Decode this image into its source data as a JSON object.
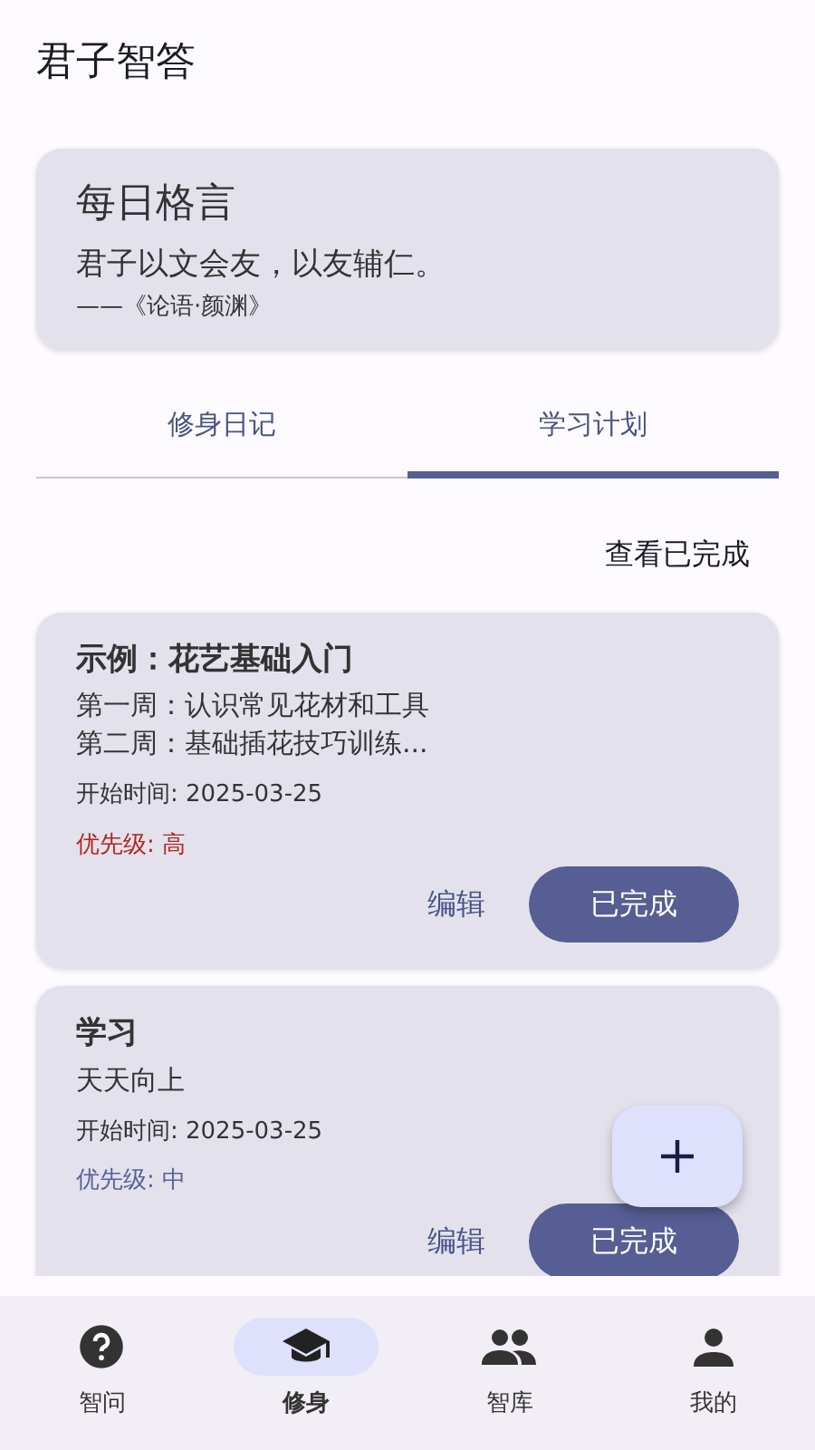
{
  "app_bar": {
    "title": "君子智答"
  },
  "quote_card": {
    "title": "每日格言",
    "text": "君子以文会友，以友辅仁。",
    "source": "——《论语·颜渊》"
  },
  "tabs": [
    {
      "label": "修身日记",
      "selected": false
    },
    {
      "label": "学习计划",
      "selected": true
    }
  ],
  "view_completed_link": "查看已完成",
  "plans": [
    {
      "title": "示例：花艺基础入门",
      "description": [
        "第一周：认识常见花材和工具",
        "第二周：基础插花技巧训练..."
      ],
      "start": "开始时间: 2025-03-25",
      "priority": "优先级: 高",
      "color": "#b3261e",
      "edit": "编辑",
      "done": "已完成"
    },
    {
      "title": "学习",
      "description": [
        "天天向上"
      ],
      "start": "开始时间: 2025-03-25",
      "priority": "优先级: 中",
      "color": "#5a6198",
      "edit": "编辑",
      "done": "已完成"
    }
  ],
  "bottom_nav": [
    {
      "label": "智问",
      "selected": false
    },
    {
      "label": "修身",
      "selected": true
    },
    {
      "label": "智库",
      "selected": false
    },
    {
      "label": "我的",
      "selected": false
    }
  ]
}
